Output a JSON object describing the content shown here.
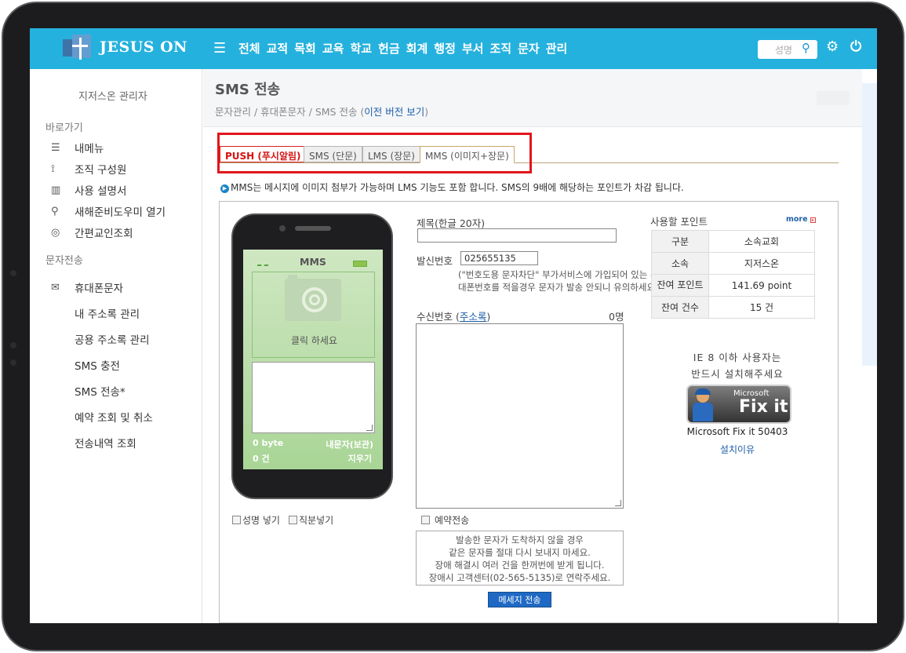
{
  "brand": "JESUS ON",
  "nav": [
    "전체",
    "교적",
    "목회",
    "교육",
    "학교",
    "헌금",
    "회계",
    "행정",
    "부서",
    "조직",
    "문자",
    "관리"
  ],
  "search": {
    "placeholder": "성명"
  },
  "sidebar": {
    "admin": "지저스온 관리자",
    "shortcut_title": "바로가기",
    "shortcuts": [
      {
        "icon": "list-icon",
        "label": "내메뉴"
      },
      {
        "icon": "org-chart-icon",
        "label": "조직 구성원"
      },
      {
        "icon": "book-icon",
        "label": "사용 설명서"
      },
      {
        "icon": "pin-icon",
        "label": "새해준비도우미 열기"
      },
      {
        "icon": "eye-icon",
        "label": "간편교인조회"
      }
    ],
    "message_title": "문자전송",
    "mobile_label": "휴대폰문자",
    "sub_items": [
      "내 주소록 관리",
      "공용 주소록 관리",
      "SMS 충전",
      "SMS 전송*",
      "예약 조회 및 취소",
      "전송내역 조회"
    ]
  },
  "page": {
    "title": "SMS 전송",
    "breadcrumb": "문자관리 / 휴대폰문자 / SMS 전송 (",
    "breadcrumb_link": "이전 버전 보기",
    "breadcrumb_end": ")"
  },
  "tabs": [
    "PUSH (푸시알림)",
    "SMS (단문)",
    "LMS (장문)",
    "MMS (이미지+장문)"
  ],
  "notice": "MMS는 메시지에 이미지 첨부가 가능하며 LMS 기능도 포함 합니다. SMS의 9배에 해당하는 포인트가 차감 됩니다.",
  "phone": {
    "title": "MMS",
    "click_text": "클릭 하세요",
    "bytes": "0 byte",
    "count": "0 건",
    "save": "내문자(보관)",
    "clear": "지우기"
  },
  "checkboxes": {
    "name": "성명 넣기",
    "position": "직분넣기",
    "reserve": "예약전송"
  },
  "form": {
    "subject_label": "제목(한글 20자)",
    "subject_value": "",
    "sender_label": "발신번호",
    "sender_value": "025655135",
    "help": "(\"번호도용 문자차단\" 부가서비스에 가입되어 있는 휴대폰번호를 적을경우 문자가 발송 안되니 유의하세요)",
    "recipient_label": "수신번호 (",
    "address_book": "주소록",
    "recipient_end": ")",
    "recipient_count": "0명",
    "warning": [
      "발송한 문자가 도착하지 않을 경우",
      "같은 문자를 절대 다시 보내지 마세요.",
      "장애 해결시 여러 건을 한꺼번에 받게 됩니다.",
      "장애시 고객센터(02-565-5135)로 연락주세요."
    ],
    "send_button": "메세지 전송"
  },
  "points": {
    "title": "사용할 포인트",
    "more": "more",
    "rows": [
      {
        "k": "구분",
        "v": "소속교회"
      },
      {
        "k": "소속",
        "v": "지저스온"
      },
      {
        "k": "잔여 포인트",
        "v": "141.69 point"
      },
      {
        "k": "잔여 건수",
        "v": "15 건"
      }
    ]
  },
  "ie_note": [
    "IE 8 이하 사용자는",
    "반드시 설치해주세요"
  ],
  "fixit": {
    "brand": "Microsoft",
    "label": "Fix it",
    "caption": "Microsoft Fix it 50403",
    "link": "설치이유"
  },
  "colors": {
    "header": "#25b1dd",
    "accent_red": "#e0161b",
    "link": "#1f5fa8",
    "send_button": "#1f69c4"
  }
}
